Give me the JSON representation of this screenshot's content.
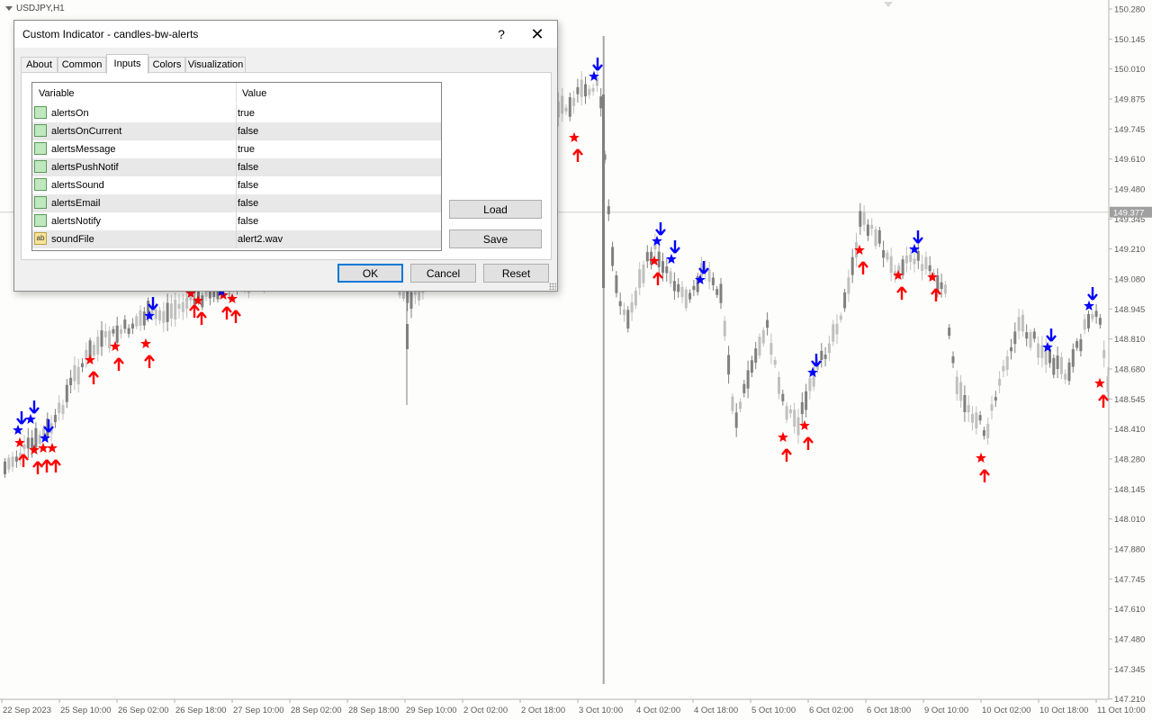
{
  "chart": {
    "symbol": "USDJPY,H1",
    "current_price": "149.377",
    "price_levels": [
      "150.280",
      "150.145",
      "150.010",
      "149.875",
      "149.745",
      "149.610",
      "149.480",
      "149.345",
      "149.210",
      "149.080",
      "148.945",
      "148.810",
      "148.680",
      "148.545",
      "148.410",
      "148.280",
      "148.145",
      "148.010",
      "147.880",
      "147.745",
      "147.610",
      "147.480",
      "147.345",
      "147.210"
    ],
    "time_labels": [
      "22 Sep 2023",
      "25 Sep 10:00",
      "26 Sep 02:00",
      "26 Sep 18:00",
      "27 Sep 10:00",
      "28 Sep 02:00",
      "28 Sep 18:00",
      "29 Sep 10:00",
      "2 Oct 02:00",
      "2 Oct 18:00",
      "3 Oct 10:00",
      "4 Oct 02:00",
      "4 Oct 18:00",
      "5 Oct 10:00",
      "6 Oct 02:00",
      "6 Oct 18:00",
      "9 Oct 10:00",
      "10 Oct 02:00",
      "10 Oct 18:00",
      "11 Oct 10:00"
    ],
    "colors": {
      "bull": "#c0c0c0",
      "bear": "#808080",
      "up_signal": "#ff0000",
      "down_signal": "#0000ff",
      "axis": "#b4b4b4",
      "text": "#5a5a5a"
    },
    "icons": {
      "up_arrow": "up-arrow-icon",
      "down_arrow": "down-arrow-icon",
      "star": "star-icon"
    }
  },
  "dialog": {
    "title": "Custom Indicator - candles-bw-alerts",
    "help_glyph": "?",
    "close_glyph": "✕",
    "tabs": [
      {
        "label": "About"
      },
      {
        "label": "Common"
      },
      {
        "label": "Inputs",
        "active": true
      },
      {
        "label": "Colors"
      },
      {
        "label": "Visualization"
      }
    ],
    "columns": {
      "variable": "Variable",
      "value": "Value"
    },
    "inputs": [
      {
        "variable": "alertsOn",
        "value": "true",
        "icon": "bool-icon"
      },
      {
        "variable": "alertsOnCurrent",
        "value": "false",
        "icon": "bool-icon"
      },
      {
        "variable": "alertsMessage",
        "value": "true",
        "icon": "bool-icon"
      },
      {
        "variable": "alertsPushNotif",
        "value": "false",
        "icon": "bool-icon"
      },
      {
        "variable": "alertsSound",
        "value": "false",
        "icon": "bool-icon"
      },
      {
        "variable": "alertsEmail",
        "value": "false",
        "icon": "bool-icon"
      },
      {
        "variable": "alertsNotify",
        "value": "false",
        "icon": "bool-icon"
      },
      {
        "variable": "soundFile",
        "value": "alert2.wav",
        "icon": "string-icon",
        "icon_text": "ab"
      }
    ],
    "buttons": {
      "load": "Load",
      "save": "Save",
      "ok": "OK",
      "cancel": "Cancel",
      "reset": "Reset"
    }
  }
}
